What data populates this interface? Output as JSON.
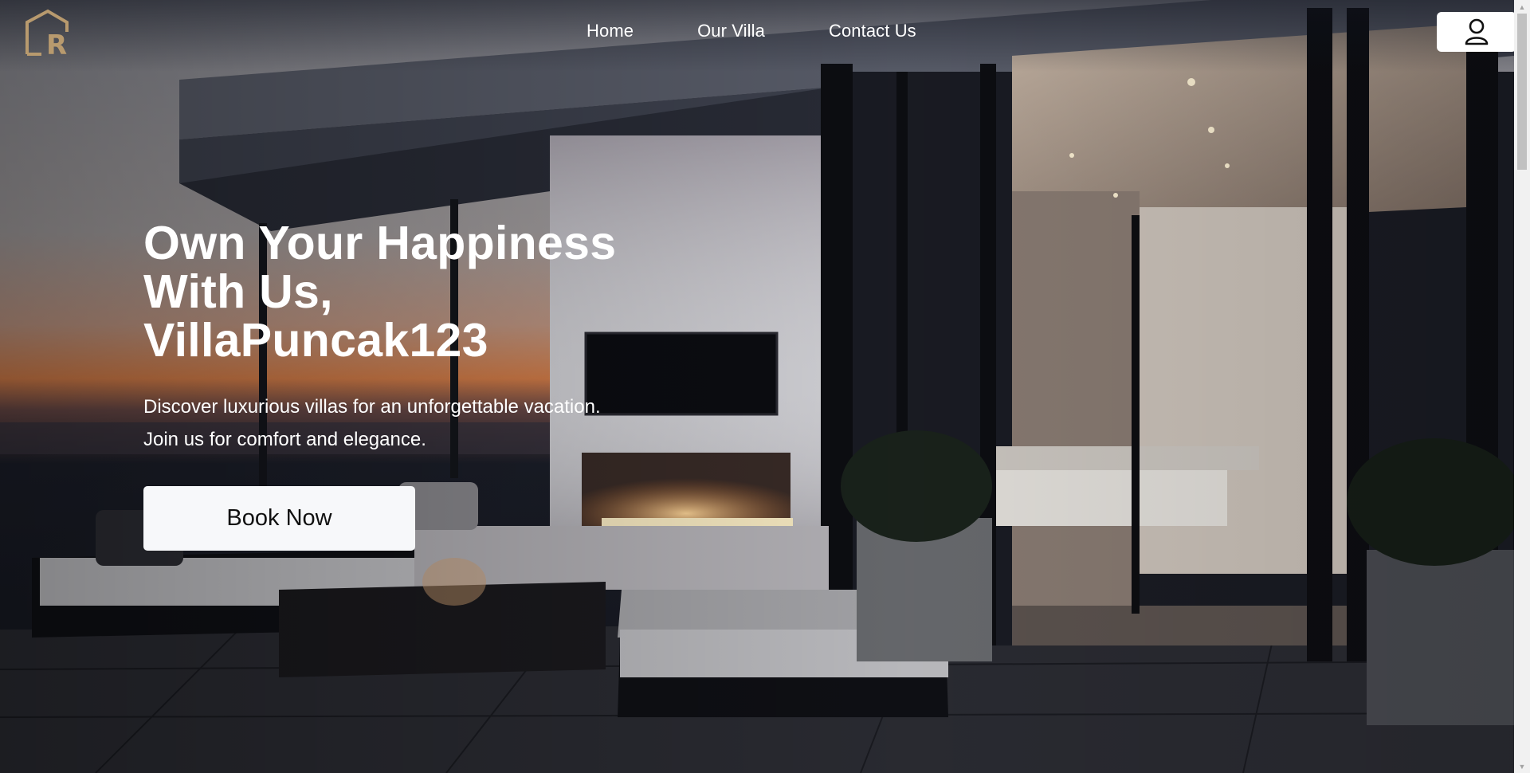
{
  "brand": {
    "logo_text": "R",
    "logo_color": "#b89a6e"
  },
  "nav": {
    "items": [
      {
        "label": "Home"
      },
      {
        "label": "Our Villa"
      },
      {
        "label": "Contact Us"
      }
    ]
  },
  "user_button": {
    "icon": "user-icon"
  },
  "hero": {
    "title_lines": [
      "Own Your Happiness",
      "With Us,",
      "VillaPuncak123"
    ],
    "subtitle_lines": [
      "Discover luxurious villas for an unforgettable vacation.",
      "Join us for comfort and elegance."
    ],
    "cta_label": "Book Now"
  },
  "colors": {
    "text_primary": "#ffffff",
    "button_bg": "#f7f8fa",
    "button_text": "#111111"
  }
}
